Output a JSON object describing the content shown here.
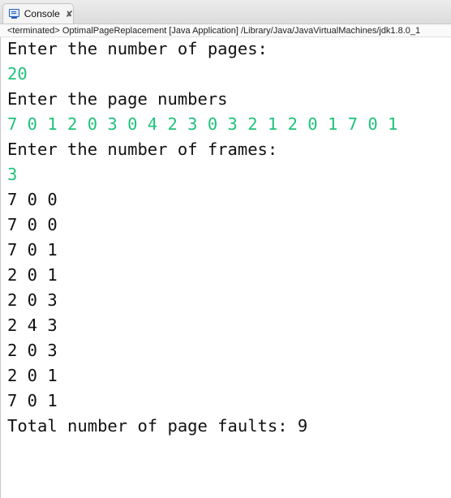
{
  "tab": {
    "label": "Console",
    "icon": "console-icon",
    "close_icon": "close-icon"
  },
  "status": "<terminated> OptimalPageReplacement [Java Application] /Library/Java/JavaVirtualMachines/jdk1.8.0_1",
  "colors": {
    "input": "#1ec27a",
    "output": "#111111"
  },
  "lines": [
    {
      "text": "Enter the number of pages:",
      "type": "output"
    },
    {
      "text": "20",
      "type": "input"
    },
    {
      "text": "Enter the page numbers",
      "type": "output"
    },
    {
      "text": "7 0 1 2 0 3 0 4 2 3 0 3 2 1 2 0 1 7 0 1",
      "type": "input"
    },
    {
      "text": "Enter the number of frames:",
      "type": "output"
    },
    {
      "text": "3",
      "type": "input"
    },
    {
      "text": "7 0 0",
      "type": "output"
    },
    {
      "text": "7 0 0",
      "type": "output"
    },
    {
      "text": "7 0 1",
      "type": "output"
    },
    {
      "text": "2 0 1",
      "type": "output"
    },
    {
      "text": "2 0 3",
      "type": "output"
    },
    {
      "text": "2 4 3",
      "type": "output"
    },
    {
      "text": "2 0 3",
      "type": "output"
    },
    {
      "text": "2 0 1",
      "type": "output"
    },
    {
      "text": "7 0 1",
      "type": "output"
    },
    {
      "text": "Total number of page faults: 9",
      "type": "output"
    }
  ]
}
